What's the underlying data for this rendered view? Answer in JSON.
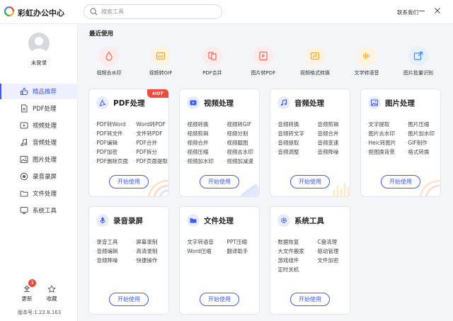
{
  "app": {
    "title": "彩虹办公中心",
    "logo_icon": "rainbow-logo-icon"
  },
  "search": {
    "placeholder": "搜索工具"
  },
  "header": {
    "contact": "联系我们"
  },
  "user": {
    "login_status": "未登录"
  },
  "sidebar": {
    "items": [
      {
        "label": "精品推荐",
        "icon": "thumbs-up-icon",
        "active": true
      },
      {
        "label": "PDF处理",
        "icon": "pdf-icon"
      },
      {
        "label": "视频处理",
        "icon": "video-icon"
      },
      {
        "label": "音频处理",
        "icon": "music-icon"
      },
      {
        "label": "图片处理",
        "icon": "image-icon"
      },
      {
        "label": "录音录屏",
        "icon": "record-icon"
      },
      {
        "label": "文件处理",
        "icon": "folder-icon"
      },
      {
        "label": "系统工具",
        "icon": "monitor-icon"
      }
    ],
    "update_label": "更新",
    "update_badge": "3",
    "favorite_label": "收藏",
    "version": "版本号:1.22.8.163"
  },
  "recent": {
    "title": "最近使用",
    "items": [
      {
        "label": "视频去水印",
        "icon": "video-watermark-icon",
        "color": "#f3645b"
      },
      {
        "label": "视频转GIF",
        "icon": "gif-icon",
        "color": "#f5a623"
      },
      {
        "label": "PDF合并",
        "icon": "pdf-merge-icon",
        "color": "#f3645b"
      },
      {
        "label": "图片转PDF",
        "icon": "image-to-pdf-icon",
        "color": "#f3645b"
      },
      {
        "label": "视频格式转换",
        "icon": "video-convert-icon",
        "color": "#f5a623"
      },
      {
        "label": "文字转语音",
        "icon": "text-to-speech-icon",
        "color": "#f5a623"
      },
      {
        "label": "图片批量识别",
        "icon": "image-recognize-icon",
        "color": "#3d8bff"
      }
    ]
  },
  "cards": [
    {
      "title": "PDF处理",
      "icon": "pdf-icon",
      "badge": "HOT",
      "features": [
        "PDF转Word",
        "Word转PDF",
        "PDF转文件",
        "文件转PDF",
        "PDF编辑",
        "PDF合并",
        "PDF加密",
        "PDF拆分",
        "PDF删除页面",
        "PDF页面提取"
      ],
      "button": "开始使用"
    },
    {
      "title": "视频处理",
      "icon": "video-icon",
      "features": [
        "视频转换",
        "视频转GIF",
        "视频剪辑",
        "视频分割",
        "视频合并",
        "视频截图",
        "视频压缩",
        "视频去水印",
        "视频加水印",
        "视频加减速"
      ],
      "button": "开始使用"
    },
    {
      "title": "音频处理",
      "icon": "music-icon",
      "features": [
        "音频转换",
        "音频剪辑",
        "音频转文字",
        "音频合并",
        "音频提取",
        "音频变速",
        "音频调整",
        "音频降噪"
      ],
      "button": "开始使用"
    },
    {
      "title": "图片处理",
      "icon": "image-icon",
      "features": [
        "文字提取",
        "图片压缩",
        "图片去水印",
        "图片加水印",
        "Heic转图片",
        "GIF制作",
        "抠图换背景",
        "格式转换"
      ],
      "button": "开始使用"
    },
    {
      "title": "录音录屏",
      "icon": "microphone-icon",
      "features": [
        "录音工具",
        "屏幕录制",
        "音频编辑",
        "高清录制",
        "音频降噪",
        "快捷操作"
      ],
      "button": "开始使用"
    },
    {
      "title": "文件处理",
      "icon": "folder-icon",
      "features": [
        "文字转语音",
        "PPT压缩",
        "Word压缩",
        "翻译助手"
      ],
      "button": "开始使用"
    },
    {
      "title": "系统工具",
      "icon": "gear-icon",
      "features": [
        "数据恢复",
        "C盘清理",
        "大文件搬家",
        "驱动管理",
        "游戏组件",
        "文件加密",
        "定时关机"
      ],
      "button": "开始使用"
    }
  ],
  "colors": {
    "accent": "#3d5afe",
    "hot": "#f04a3e"
  }
}
